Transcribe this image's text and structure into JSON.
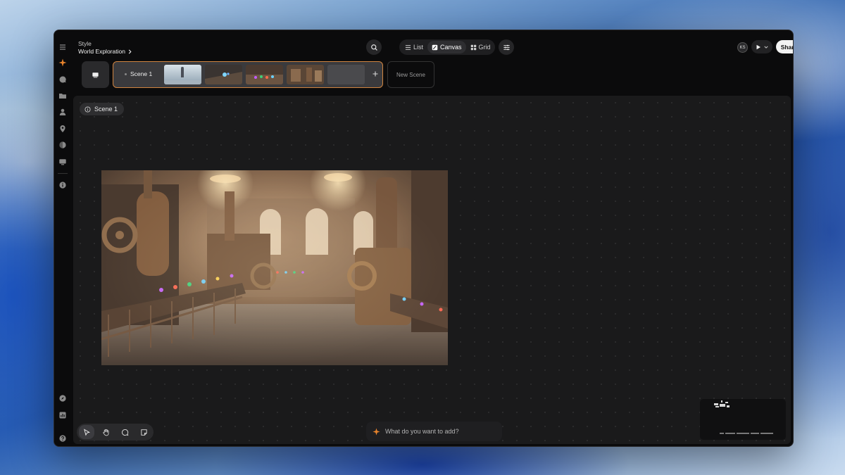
{
  "header": {
    "section_label": "Style",
    "project_title": "World Exploration",
    "view_tabs": [
      {
        "label": "List",
        "icon": "list-icon"
      },
      {
        "label": "Canvas",
        "icon": "canvas-icon"
      },
      {
        "label": "Grid",
        "icon": "grid-icon"
      }
    ],
    "active_view": "Canvas",
    "user_initials": "KS",
    "share_label": "Share"
  },
  "scene_strip": {
    "scene_name": "Scene 1",
    "new_scene_label": "New Scene"
  },
  "canvas": {
    "scene_chip_label": "Scene 1",
    "prompt_placeholder": "What do you want to add?"
  },
  "colors": {
    "accent": "#e8842c",
    "selection_border": "#d0843f",
    "background": "#0b0b0c",
    "canvas": "#1a1a1b"
  }
}
